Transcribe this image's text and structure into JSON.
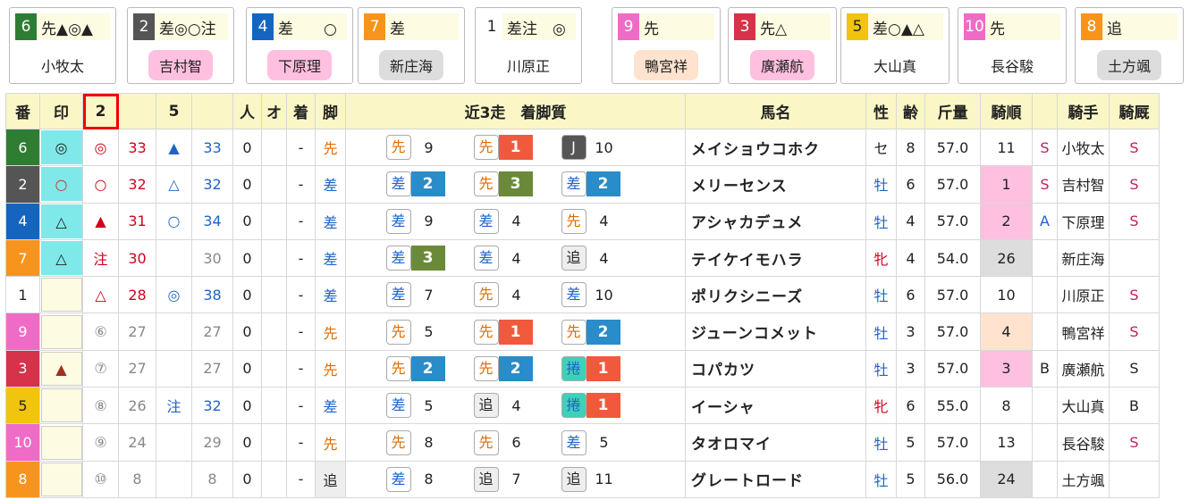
{
  "cards": [
    {
      "num": "6",
      "num_bg": "#2e7d32",
      "num_fg": "#fff",
      "text": "先▲◎▲",
      "name": "小牧太",
      "name_bg": "#fff"
    },
    {
      "num": "2",
      "num_bg": "#555",
      "num_fg": "#fff",
      "text": "差◎○注",
      "name": "吉村智",
      "name_bg": "#ffc0e0"
    },
    {
      "num": "4",
      "num_bg": "#1565c0",
      "num_fg": "#fff",
      "text": "差　　○",
      "name": "下原理",
      "name_bg": "#ffc0e0"
    },
    {
      "num": "7",
      "num_bg": "#f7941d",
      "num_fg": "#fff",
      "text": "差",
      "name": "新庄海",
      "name_bg": "#ddd"
    },
    {
      "num": "1",
      "num_bg": "#fff",
      "num_fg": "#222",
      "text": "差注　◎",
      "name": "川原正",
      "name_bg": "#fff"
    },
    {
      "num": "9",
      "num_bg": "#ef6cc6",
      "num_fg": "#fff",
      "text": "先",
      "name": "鴨宮祥",
      "name_bg": "#ffe3cf"
    },
    {
      "num": "3",
      "num_bg": "#d6324a",
      "num_fg": "#fff",
      "text": "先△",
      "name": "廣瀬航",
      "name_bg": "#ffc0e0"
    },
    {
      "num": "5",
      "num_bg": "#f1c40f",
      "num_fg": "#222",
      "text": "差○▲△",
      "name": "大山真",
      "name_bg": "#fff"
    },
    {
      "num": "10",
      "num_bg": "#ef6cc6",
      "num_fg": "#fff",
      "text": "先",
      "name": "長谷駿",
      "name_bg": "#fff"
    },
    {
      "num": "8",
      "num_bg": "#f7941d",
      "num_fg": "#fff",
      "text": "追",
      "name": "土方颯",
      "name_bg": "#ddd"
    }
  ],
  "headers": {
    "ban": "番",
    "shirushi": "印",
    "p1": "2",
    "p2": "5",
    "hito": "人",
    "o": "オ",
    "chaku": "着",
    "ashi": "脚",
    "recent": "近3走　着脚質",
    "horse": "馬名",
    "sex": "性",
    "age": "齢",
    "weight": "斤量",
    "kijun": "騎順",
    "jockey": "騎手",
    "kireki": "騎厩"
  },
  "colors": {
    "red": "#d0021b",
    "blue": "#1e64c8",
    "orange": "#e06c00",
    "gray": "#888",
    "green_box": "#6a8a3a",
    "blue_box": "#2a8cc8",
    "red_box": "#f05a3c",
    "dark_box": "#555",
    "teal": "#7fe8e8",
    "pink": "#ffc0e0",
    "peach": "#ffe3cf",
    "lgray": "#ddd"
  },
  "rows": [
    {
      "ban": "6",
      "ban_bg": "#2e7d32",
      "ban_fg": "#fff",
      "mark": "◎",
      "mark_bg": "#7fe8e8",
      "mark_color": "#222",
      "p1_mark": "◎",
      "p1_color": "#d0021b",
      "p1_score": "33",
      "p1_score_color": "#d0021b",
      "p2_mark": "▲",
      "p2_color": "#1e64c8",
      "p2_score": "33",
      "p2_score_color": "#1e64c8",
      "hito": "0",
      "o": "",
      "chaku": "-",
      "ashi": "先",
      "ashi_color": "#e06c00",
      "ashi_bg": "",
      "races": [
        {
          "style": "先",
          "style_color": "#e06c00",
          "style_bg": "#fff",
          "rank": "9",
          "rank_bg": "",
          "rank_fg": "#222"
        },
        {
          "style": "先",
          "style_color": "#e06c00",
          "style_bg": "#fff",
          "rank": "1",
          "rank_bg": "#f05a3c",
          "rank_fg": "#fff"
        },
        {
          "style": "J",
          "style_color": "#fff",
          "style_bg": "#555",
          "rank": "10",
          "rank_bg": "",
          "rank_fg": "#222"
        }
      ],
      "name": "メイショウコホク",
      "sex": "セ",
      "sex_color": "#222",
      "age": "8",
      "weight": "57.0",
      "kijun": "11",
      "kijun_bg": "",
      "ks": "S",
      "ks_color": "#c02060",
      "jockey": "小牧太",
      "kireki": "S",
      "kireki_color": "#c02060"
    },
    {
      "ban": "2",
      "ban_bg": "#555",
      "ban_fg": "#fff",
      "mark": "○",
      "mark_bg": "#7fe8e8",
      "mark_color": "#c0392b",
      "p1_mark": "○",
      "p1_color": "#d0021b",
      "p1_score": "32",
      "p1_score_color": "#d0021b",
      "p2_mark": "△",
      "p2_color": "#1e64c8",
      "p2_score": "32",
      "p2_score_color": "#1e64c8",
      "hito": "0",
      "o": "",
      "chaku": "-",
      "ashi": "差",
      "ashi_color": "#1e64c8",
      "ashi_bg": "",
      "races": [
        {
          "style": "差",
          "style_color": "#1e64c8",
          "style_bg": "#fff",
          "rank": "2",
          "rank_bg": "#2a8cc8",
          "rank_fg": "#fff"
        },
        {
          "style": "先",
          "style_color": "#e06c00",
          "style_bg": "#fff",
          "rank": "3",
          "rank_bg": "#6a8a3a",
          "rank_fg": "#fff"
        },
        {
          "style": "差",
          "style_color": "#1e64c8",
          "style_bg": "#fff",
          "rank": "2",
          "rank_bg": "#2a8cc8",
          "rank_fg": "#fff"
        }
      ],
      "name": "メリーセンス",
      "sex": "牡",
      "sex_color": "#1e64c8",
      "age": "6",
      "weight": "57.0",
      "kijun": "1",
      "kijun_bg": "#ffc0e0",
      "ks": "S",
      "ks_color": "#c02060",
      "jockey": "吉村智",
      "kireki": "S",
      "kireki_color": "#c02060"
    },
    {
      "ban": "4",
      "ban_bg": "#1565c0",
      "ban_fg": "#fff",
      "mark": "△",
      "mark_bg": "#7fe8e8",
      "mark_color": "#222",
      "p1_mark": "▲",
      "p1_color": "#d0021b",
      "p1_score": "31",
      "p1_score_color": "#d0021b",
      "p2_mark": "○",
      "p2_color": "#1e64c8",
      "p2_score": "34",
      "p2_score_color": "#1e64c8",
      "hito": "0",
      "o": "",
      "chaku": "-",
      "ashi": "差",
      "ashi_color": "#1e64c8",
      "ashi_bg": "",
      "races": [
        {
          "style": "差",
          "style_color": "#1e64c8",
          "style_bg": "#fff",
          "rank": "9",
          "rank_bg": "",
          "rank_fg": "#222"
        },
        {
          "style": "差",
          "style_color": "#1e64c8",
          "style_bg": "#fff",
          "rank": "4",
          "rank_bg": "",
          "rank_fg": "#222"
        },
        {
          "style": "先",
          "style_color": "#e06c00",
          "style_bg": "#fff",
          "rank": "4",
          "rank_bg": "",
          "rank_fg": "#222"
        }
      ],
      "name": "アシャカデュメ",
      "sex": "牡",
      "sex_color": "#1e64c8",
      "age": "4",
      "weight": "57.0",
      "kijun": "2",
      "kijun_bg": "#ffc0e0",
      "ks": "A",
      "ks_color": "#1e64c8",
      "jockey": "下原理",
      "kireki": "S",
      "kireki_color": "#c02060"
    },
    {
      "ban": "7",
      "ban_bg": "#f7941d",
      "ban_fg": "#fff",
      "mark": "△",
      "mark_bg": "#7fe8e8",
      "mark_color": "#222",
      "p1_mark": "注",
      "p1_color": "#d0021b",
      "p1_score": "30",
      "p1_score_color": "#d0021b",
      "p2_mark": "",
      "p2_color": "#1e64c8",
      "p2_score": "30",
      "p2_score_color": "#888",
      "hito": "0",
      "o": "",
      "chaku": "-",
      "ashi": "差",
      "ashi_color": "#1e64c8",
      "ashi_bg": "",
      "races": [
        {
          "style": "差",
          "style_color": "#1e64c8",
          "style_bg": "#fff",
          "rank": "3",
          "rank_bg": "#6a8a3a",
          "rank_fg": "#fff"
        },
        {
          "style": "差",
          "style_color": "#1e64c8",
          "style_bg": "#fff",
          "rank": "4",
          "rank_bg": "",
          "rank_fg": "#222"
        },
        {
          "style": "追",
          "style_color": "#222",
          "style_bg": "#eee",
          "rank": "4",
          "rank_bg": "",
          "rank_fg": "#222"
        }
      ],
      "name": "テイケイモハラ",
      "sex": "牝",
      "sex_color": "#d0021b",
      "age": "4",
      "weight": "54.0",
      "kijun": "26",
      "kijun_bg": "#ddd",
      "ks": "",
      "ks_color": "#222",
      "jockey": "新庄海",
      "kireki": "",
      "kireki_color": "#222"
    },
    {
      "ban": "1",
      "ban_bg": "#fff",
      "ban_fg": "#222",
      "mark": "",
      "mark_bg": "#fdfbe1",
      "mark_color": "#222",
      "p1_mark": "△",
      "p1_color": "#d0021b",
      "p1_score": "28",
      "p1_score_color": "#d0021b",
      "p2_mark": "◎",
      "p2_color": "#1e64c8",
      "p2_score": "38",
      "p2_score_color": "#1e64c8",
      "hito": "0",
      "o": "",
      "chaku": "-",
      "ashi": "差",
      "ashi_color": "#1e64c8",
      "ashi_bg": "",
      "races": [
        {
          "style": "差",
          "style_color": "#1e64c8",
          "style_bg": "#fff",
          "rank": "7",
          "rank_bg": "",
          "rank_fg": "#222"
        },
        {
          "style": "先",
          "style_color": "#e06c00",
          "style_bg": "#fff",
          "rank": "4",
          "rank_bg": "",
          "rank_fg": "#222"
        },
        {
          "style": "差",
          "style_color": "#1e64c8",
          "style_bg": "#fff",
          "rank": "10",
          "rank_bg": "",
          "rank_fg": "#222"
        }
      ],
      "name": "ポリクシニーズ",
      "sex": "牡",
      "sex_color": "#1e64c8",
      "age": "6",
      "weight": "57.0",
      "kijun": "10",
      "kijun_bg": "",
      "ks": "",
      "ks_color": "#222",
      "jockey": "川原正",
      "kireki": "S",
      "kireki_color": "#c02060"
    },
    {
      "ban": "9",
      "ban_bg": "#ef6cc6",
      "ban_fg": "#fff",
      "mark": "",
      "mark_bg": "#fdfbe1",
      "mark_color": "#222",
      "p1_mark": "⑥",
      "p1_color": "#888",
      "p1_score": "27",
      "p1_score_color": "#888",
      "p2_mark": "",
      "p2_color": "#1e64c8",
      "p2_score": "27",
      "p2_score_color": "#888",
      "hito": "0",
      "o": "",
      "chaku": "-",
      "ashi": "先",
      "ashi_color": "#e06c00",
      "ashi_bg": "",
      "races": [
        {
          "style": "先",
          "style_color": "#e06c00",
          "style_bg": "#fff",
          "rank": "5",
          "rank_bg": "",
          "rank_fg": "#222"
        },
        {
          "style": "先",
          "style_color": "#e06c00",
          "style_bg": "#fff",
          "rank": "1",
          "rank_bg": "#f05a3c",
          "rank_fg": "#fff"
        },
        {
          "style": "先",
          "style_color": "#e06c00",
          "style_bg": "#fff",
          "rank": "2",
          "rank_bg": "#2a8cc8",
          "rank_fg": "#fff"
        }
      ],
      "name": "ジューンコメット",
      "sex": "牡",
      "sex_color": "#1e64c8",
      "age": "3",
      "weight": "57.0",
      "kijun": "4",
      "kijun_bg": "#ffe3cf",
      "ks": "",
      "ks_color": "#222",
      "jockey": "鴨宮祥",
      "kireki": "S",
      "kireki_color": "#c02060"
    },
    {
      "ban": "3",
      "ban_bg": "#d6324a",
      "ban_fg": "#fff",
      "mark": "▲",
      "mark_bg": "#fdfbe1",
      "mark_color": "#a03020",
      "p1_mark": "⑦",
      "p1_color": "#888",
      "p1_score": "27",
      "p1_score_color": "#888",
      "p2_mark": "",
      "p2_color": "#1e64c8",
      "p2_score": "27",
      "p2_score_color": "#888",
      "hito": "0",
      "o": "",
      "chaku": "-",
      "ashi": "先",
      "ashi_color": "#e06c00",
      "ashi_bg": "",
      "races": [
        {
          "style": "先",
          "style_color": "#e06c00",
          "style_bg": "#fff",
          "rank": "2",
          "rank_bg": "#2a8cc8",
          "rank_fg": "#fff"
        },
        {
          "style": "先",
          "style_color": "#e06c00",
          "style_bg": "#fff",
          "rank": "2",
          "rank_bg": "#2a8cc8",
          "rank_fg": "#fff"
        },
        {
          "style": "捲",
          "style_color": "#1e64c8",
          "style_bg": "#3fd0b8",
          "rank": "1",
          "rank_bg": "#f05a3c",
          "rank_fg": "#fff"
        }
      ],
      "name": "コパカツ",
      "sex": "牡",
      "sex_color": "#1e64c8",
      "age": "3",
      "weight": "57.0",
      "kijun": "3",
      "kijun_bg": "#ffc0e0",
      "ks": "B",
      "ks_color": "#222",
      "jockey": "廣瀬航",
      "kireki": "S",
      "kireki_color": "#222"
    },
    {
      "ban": "5",
      "ban_bg": "#f1c40f",
      "ban_fg": "#222",
      "mark": "",
      "mark_bg": "#fdfbe1",
      "mark_color": "#222",
      "p1_mark": "⑧",
      "p1_color": "#888",
      "p1_score": "26",
      "p1_score_color": "#888",
      "p2_mark": "注",
      "p2_color": "#1e64c8",
      "p2_score": "32",
      "p2_score_color": "#1e64c8",
      "hito": "0",
      "o": "",
      "chaku": "-",
      "ashi": "差",
      "ashi_color": "#1e64c8",
      "ashi_bg": "",
      "races": [
        {
          "style": "差",
          "style_color": "#1e64c8",
          "style_bg": "#fff",
          "rank": "5",
          "rank_bg": "",
          "rank_fg": "#222"
        },
        {
          "style": "追",
          "style_color": "#222",
          "style_bg": "#eee",
          "rank": "4",
          "rank_bg": "",
          "rank_fg": "#222"
        },
        {
          "style": "捲",
          "style_color": "#1e64c8",
          "style_bg": "#3fd0b8",
          "rank": "1",
          "rank_bg": "#f05a3c",
          "rank_fg": "#fff"
        }
      ],
      "name": "イーシャ",
      "sex": "牝",
      "sex_color": "#d0021b",
      "age": "6",
      "weight": "55.0",
      "kijun": "8",
      "kijun_bg": "",
      "ks": "",
      "ks_color": "#222",
      "jockey": "大山真",
      "kireki": "B",
      "kireki_color": "#222"
    },
    {
      "ban": "10",
      "ban_bg": "#ef6cc6",
      "ban_fg": "#fff",
      "mark": "",
      "mark_bg": "#fdfbe1",
      "mark_color": "#222",
      "p1_mark": "⑨",
      "p1_color": "#888",
      "p1_score": "24",
      "p1_score_color": "#888",
      "p2_mark": "",
      "p2_color": "#1e64c8",
      "p2_score": "29",
      "p2_score_color": "#888",
      "hito": "0",
      "o": "",
      "chaku": "-",
      "ashi": "先",
      "ashi_color": "#e06c00",
      "ashi_bg": "",
      "races": [
        {
          "style": "先",
          "style_color": "#e06c00",
          "style_bg": "#fff",
          "rank": "8",
          "rank_bg": "",
          "rank_fg": "#222"
        },
        {
          "style": "先",
          "style_color": "#e06c00",
          "style_bg": "#fff",
          "rank": "6",
          "rank_bg": "",
          "rank_fg": "#222"
        },
        {
          "style": "差",
          "style_color": "#1e64c8",
          "style_bg": "#fff",
          "rank": "5",
          "rank_bg": "",
          "rank_fg": "#222"
        }
      ],
      "name": "タオロマイ",
      "sex": "牡",
      "sex_color": "#1e64c8",
      "age": "5",
      "weight": "57.0",
      "kijun": "13",
      "kijun_bg": "",
      "ks": "",
      "ks_color": "#222",
      "jockey": "長谷駿",
      "kireki": "S",
      "kireki_color": "#c02060"
    },
    {
      "ban": "8",
      "ban_bg": "#f7941d",
      "ban_fg": "#fff",
      "mark": "",
      "mark_bg": "#fdfbe1",
      "mark_color": "#222",
      "p1_mark": "⑩",
      "p1_color": "#888",
      "p1_score": "8",
      "p1_score_color": "#888",
      "p2_mark": "",
      "p2_color": "#1e64c8",
      "p2_score": "8",
      "p2_score_color": "#888",
      "hito": "0",
      "o": "",
      "chaku": "-",
      "ashi": "追",
      "ashi_color": "#222",
      "ashi_bg": "#eee",
      "races": [
        {
          "style": "差",
          "style_color": "#1e64c8",
          "style_bg": "#fff",
          "rank": "8",
          "rank_bg": "",
          "rank_fg": "#222"
        },
        {
          "style": "追",
          "style_color": "#222",
          "style_bg": "#eee",
          "rank": "7",
          "rank_bg": "",
          "rank_fg": "#222"
        },
        {
          "style": "追",
          "style_color": "#222",
          "style_bg": "#eee",
          "rank": "11",
          "rank_bg": "",
          "rank_fg": "#222"
        }
      ],
      "name": "グレートロード",
      "sex": "牡",
      "sex_color": "#1e64c8",
      "age": "5",
      "weight": "56.0",
      "kijun": "24",
      "kijun_bg": "#ddd",
      "ks": "",
      "ks_color": "#222",
      "jockey": "土方颯",
      "kireki": "",
      "kireki_color": "#222"
    }
  ]
}
